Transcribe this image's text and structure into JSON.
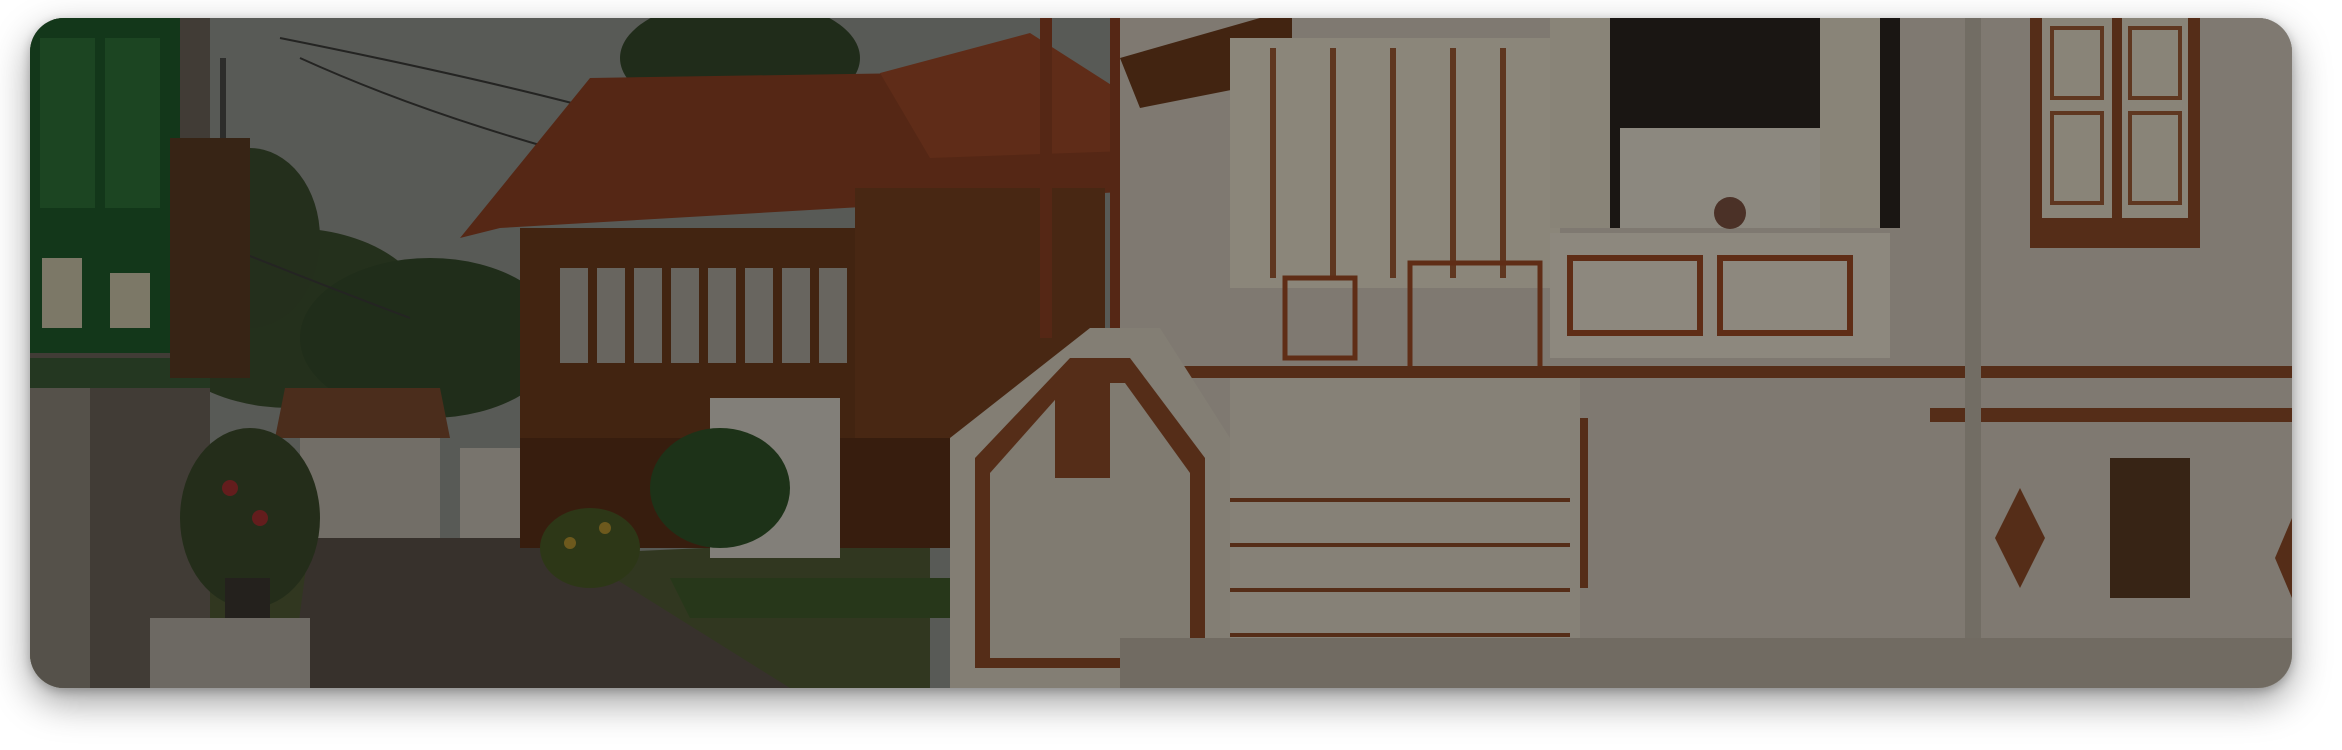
{
  "image": {
    "subject": "street-scene-photo",
    "overlay": "dimmed"
  },
  "palette": {
    "sky": "#8f918c",
    "roof": "#8a3f22",
    "wood": "#6b3a1c",
    "wall": "#cdc4b6",
    "trim": "#8a4a28",
    "shutter-green": "#1f5a2a",
    "foliage": "#2f4a26",
    "road": "#5a5048"
  }
}
